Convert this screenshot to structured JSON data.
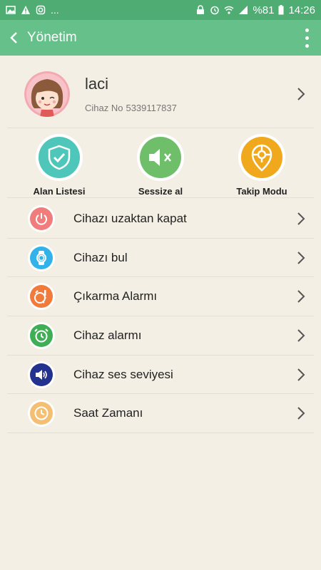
{
  "status_bar": {
    "ellipsis": "...",
    "battery": "%81",
    "time": "14:26"
  },
  "app_bar": {
    "title": "Yönetim"
  },
  "profile": {
    "name": "laci",
    "device_label": "Cihaz No",
    "device_no": "5339117837"
  },
  "quick_actions": [
    {
      "label": "Alan Listesi",
      "color": "#4fc6ba"
    },
    {
      "label": "Sessize al",
      "color": "#6fbf6a"
    },
    {
      "label": "Takip Modu",
      "color": "#f0a81c"
    }
  ],
  "menu": [
    {
      "label": "Cihazı uzaktan kapat",
      "icon": "power-icon",
      "color": "#f07c7c"
    },
    {
      "label": "Cihazı bul",
      "icon": "watch-icon",
      "color": "#31b2e8"
    },
    {
      "label": "Çıkarma Alarmı",
      "icon": "watch-alert-icon",
      "color": "#f07b3a"
    },
    {
      "label": "Cihaz alarmı",
      "icon": "alarm-clock-icon",
      "color": "#3fae55"
    },
    {
      "label": "Cihaz ses seviyesi",
      "icon": "volume-icon",
      "color": "#23318f"
    },
    {
      "label": "Saat Zamanı",
      "icon": "clock-icon",
      "color": "#f5bf73"
    }
  ]
}
